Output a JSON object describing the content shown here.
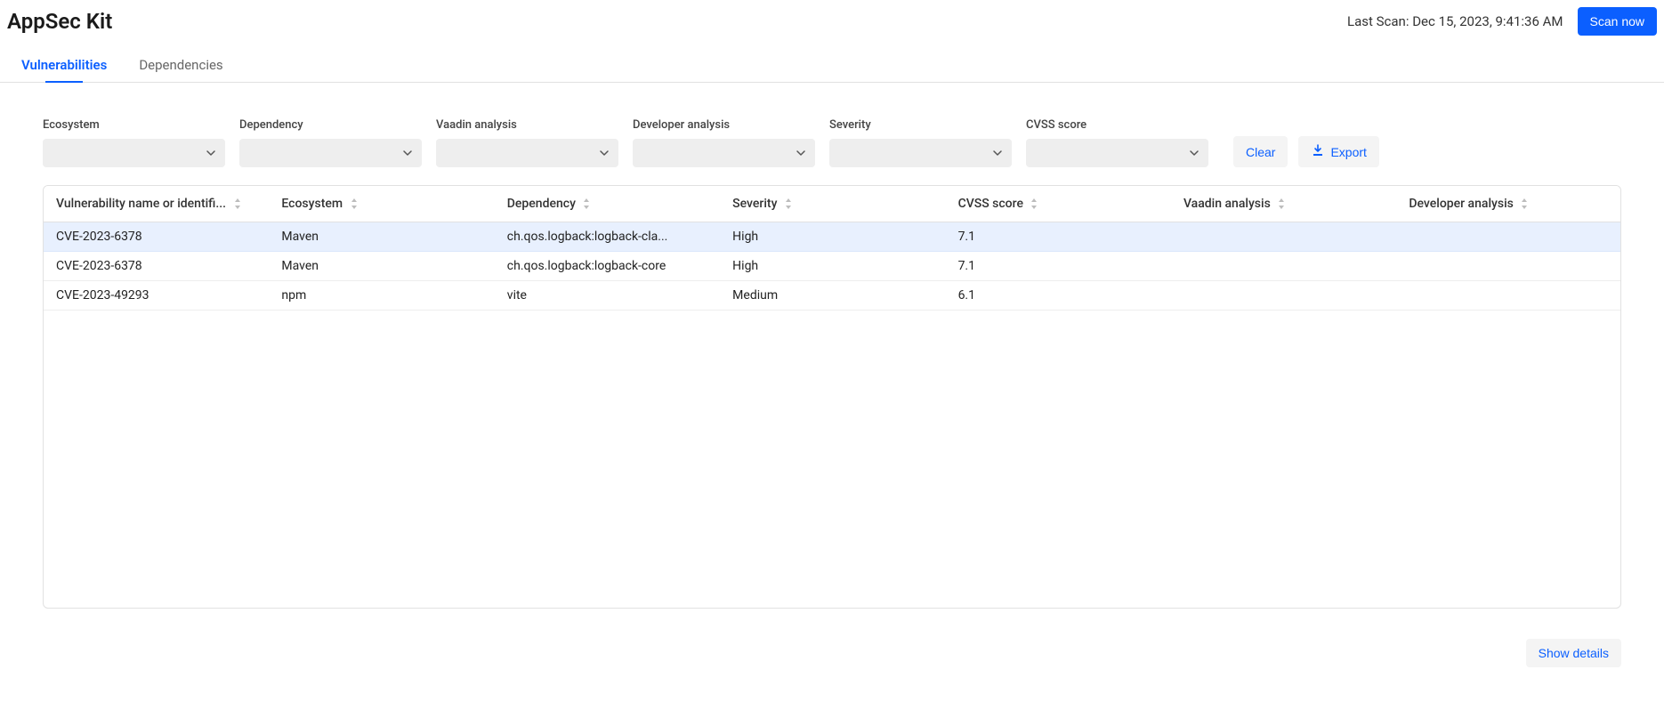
{
  "header": {
    "title": "AppSec Kit",
    "last_scan": "Last Scan: Dec 15, 2023, 9:41:36 AM",
    "scan_now_label": "Scan now"
  },
  "tabs": {
    "vulnerabilities": "Vulnerabilities",
    "dependencies": "Dependencies"
  },
  "filters": {
    "ecosystem_label": "Ecosystem",
    "dependency_label": "Dependency",
    "vaadin_analysis_label": "Vaadin analysis",
    "developer_analysis_label": "Developer analysis",
    "severity_label": "Severity",
    "cvss_score_label": "CVSS score",
    "clear_label": "Clear",
    "export_label": "Export"
  },
  "table": {
    "columns": {
      "vuln_name": "Vulnerability name or identifi...",
      "ecosystem": "Ecosystem",
      "dependency": "Dependency",
      "severity": "Severity",
      "cvss": "CVSS score",
      "vaadin_analysis": "Vaadin analysis",
      "developer_analysis": "Developer analysis"
    },
    "rows": [
      {
        "id": "CVE-2023-6378",
        "ecosystem": "Maven",
        "dependency": "ch.qos.logback:logback-cla...",
        "severity": "High",
        "cvss": "7.1",
        "vaadin": "",
        "dev": ""
      },
      {
        "id": "CVE-2023-6378",
        "ecosystem": "Maven",
        "dependency": "ch.qos.logback:logback-core",
        "severity": "High",
        "cvss": "7.1",
        "vaadin": "",
        "dev": ""
      },
      {
        "id": "CVE-2023-49293",
        "ecosystem": "npm",
        "dependency": "vite",
        "severity": "Medium",
        "cvss": "6.1",
        "vaadin": "",
        "dev": ""
      }
    ]
  },
  "footer": {
    "show_details_label": "Show details"
  }
}
